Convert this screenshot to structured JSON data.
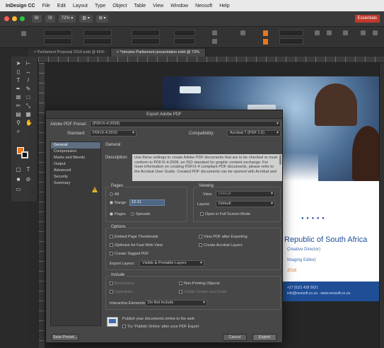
{
  "menubar": {
    "app_name": "InDesign CC",
    "items": [
      "File",
      "Edit",
      "Layout",
      "Type",
      "Object",
      "Table",
      "View",
      "Window",
      "Neosoft",
      "Help"
    ]
  },
  "apptop": {
    "zoom": "72% ▾",
    "view_chip": "▥ ▾",
    "screen_chip": "⊞ ▾",
    "brand": "Essentials"
  },
  "tabs": [
    {
      "label": "× Parliament Proposal 2016.indd @ 66%",
      "active": false
    },
    {
      "label": "× *minutes Parliament presentation.indd @ 72%",
      "active": true
    }
  ],
  "document": {
    "headline": "Republic of South Africa",
    "line_1": "Creative Director)",
    "line_2": "Imaging Editor)",
    "line_3": "2016",
    "blue_lines": [
      "+27 (0)21 428 3621",
      "info@neosoft.co.za  ·  www.neosoft.co.za"
    ]
  },
  "dialog": {
    "title": "Export Adobe PDF",
    "preset_label": "Adobe PDF Preset:",
    "preset_value": "[PDF/X-4:2008]",
    "standard_label": "Standard:",
    "standard_value": "PDF/X-4:2010",
    "compat_label": "Compatibility:",
    "compat_value": "Acrobat 7 (PDF 1.6)",
    "sidebar": [
      {
        "label": "General",
        "active": true
      },
      {
        "label": "Compression",
        "active": false
      },
      {
        "label": "Marks and Bleeds",
        "active": false
      },
      {
        "label": "Output",
        "active": false
      },
      {
        "label": "Advanced",
        "active": false
      },
      {
        "label": "Security",
        "active": false
      },
      {
        "label": "Summary",
        "active": false
      }
    ],
    "section_title": "General",
    "description_label": "Description:",
    "description": "Use these settings to create Adobe PDF documents that are to be checked or must conform to PDF/X-4:2008, an ISO standard for graphic content exchange. For more information on creating PDF/X-4 compliant PDF documents, please refer to the Acrobat User Guide. Created PDF documents can be opened with Acrobat and",
    "pages": {
      "title": "Pages",
      "all": "All",
      "range_label": "Range:",
      "range_value": "12-11",
      "pages_radio": "Pages",
      "spreads_radio": "Spreads"
    },
    "viewing": {
      "title": "Viewing",
      "view_label": "View:",
      "view_value": "Default",
      "layout_label": "Layout:",
      "layout_value": "Default",
      "fullscreen": "Open in Full Screen Mode"
    },
    "options": {
      "title": "Options",
      "embed": "Embed Page Thumbnails",
      "optimize": "Optimize for Fast Web View",
      "tagged": "Create Tagged PDF",
      "view_after": "View PDF after Exporting",
      "acrobat_layers": "Create Acrobat Layers",
      "export_layers_label": "Export Layers:",
      "export_layers_value": "Visible & Printable Layers"
    },
    "include": {
      "title": "Include",
      "bookmarks": "Bookmarks",
      "hyperlinks": "Hyperlinks",
      "nonprinting": "Non-Printing Objects",
      "visible_guides": "Visible Guides and Grids",
      "interactive_label": "Interactive Elements:",
      "interactive_value": "Do Not Include"
    },
    "publish": {
      "text": "Publish your documents online to the web",
      "checkbox": "Try 'Publish Online' after your PDF Export"
    },
    "buttons": {
      "save_preset": "Save Preset...",
      "cancel": "Cancel",
      "export": "Export"
    }
  },
  "colors": {
    "dialog_bg": "#474747",
    "accent_orange": "#e8781f",
    "selection_blue": "#5f6e82",
    "document_blue": "#1f4e96",
    "warning_yellow": "#e9b625"
  }
}
